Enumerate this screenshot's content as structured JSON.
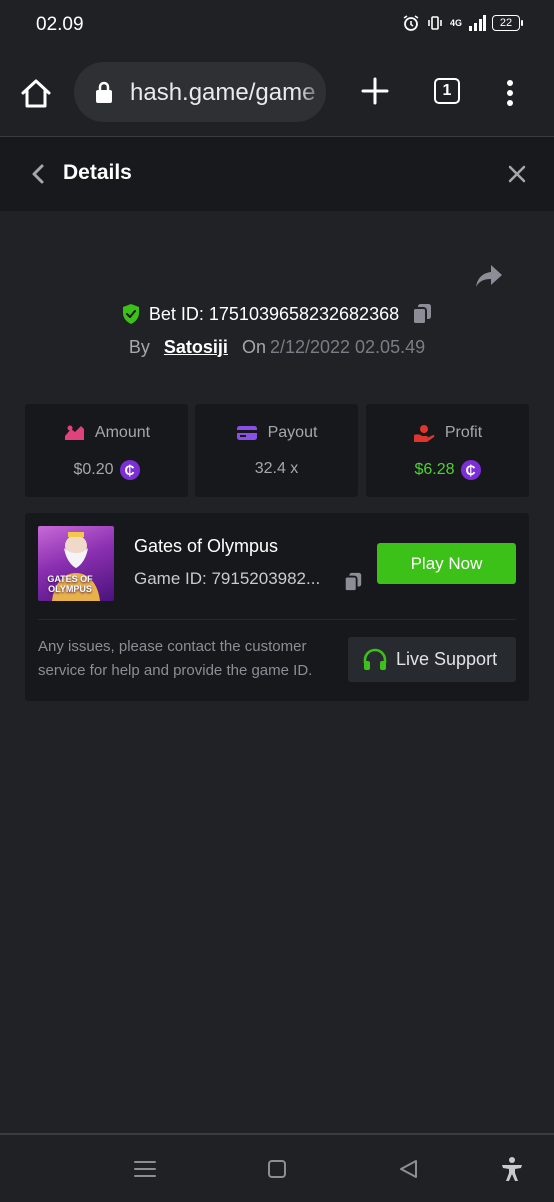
{
  "status_bar": {
    "time": "02.09",
    "network": "4G",
    "battery": "22"
  },
  "browser": {
    "url": "hash.game/game",
    "tab_count": "1"
  },
  "header": {
    "title": "Details"
  },
  "bet": {
    "id_label": "Bet ID: 1751039658232682368",
    "by_label": "By",
    "username": "Satosiji",
    "on_label": "On",
    "date": "2/12/2022 02.05.49"
  },
  "stats": {
    "amount": {
      "label": "Amount",
      "value": "$0.20",
      "coin": "₵"
    },
    "payout": {
      "label": "Payout",
      "value": "32.4 x"
    },
    "profit": {
      "label": "Profit",
      "value": "$6.28",
      "coin": "₵"
    }
  },
  "game": {
    "name": "Gates of Olympus",
    "id_label": "Game ID: 7915203982...",
    "thumbnail_text": "GATES OF OLYMPUS",
    "play_button": "Play Now",
    "notice": "Any issues, please contact the customer service for help and provide the game ID.",
    "support_button": "Live Support"
  },
  "colors": {
    "accent_green": "#3bc117",
    "profit_green": "#4fd135",
    "coin_purple": "#7c2fd6",
    "amount_icon": "#e0427a",
    "payout_icon": "#8a4fe8",
    "profit_icon": "#e0342e",
    "shield_green": "#3bc117"
  }
}
